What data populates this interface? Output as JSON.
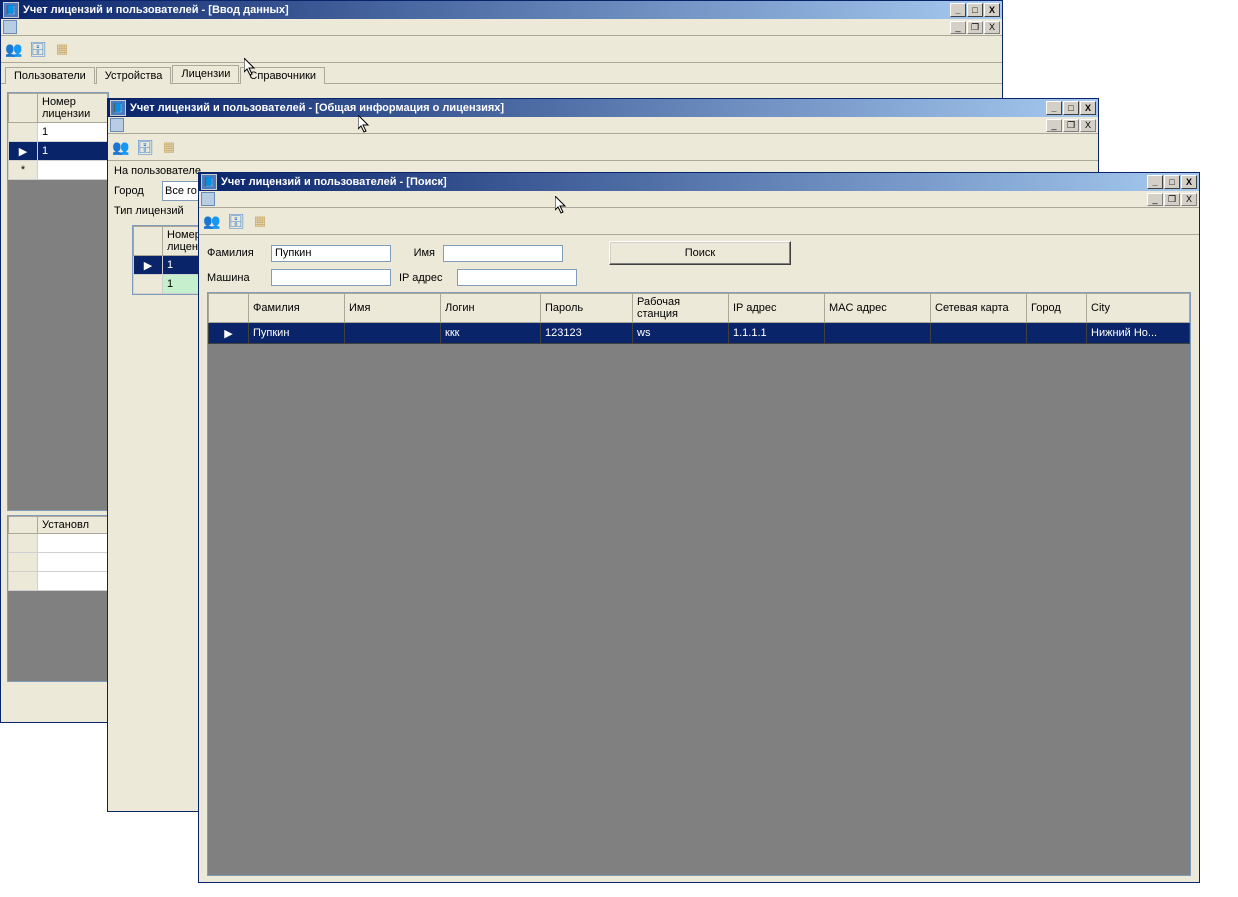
{
  "win1": {
    "title": "Учет лицензий и пользователей - [Ввод данных]",
    "tabs": [
      "Пользователи",
      "Устройства",
      "Лицензии",
      "Справочники"
    ],
    "active_tab": 2,
    "grid1": {
      "headers": [
        "Номер лицензии"
      ],
      "rows": [
        {
          "sel": false,
          "cells": [
            "1"
          ]
        },
        {
          "sel": true,
          "cells": [
            "1"
          ]
        },
        {
          "sel": false,
          "new": true,
          "cells": [
            ""
          ]
        }
      ]
    },
    "grid2": {
      "headers": [
        "Установл"
      ]
    }
  },
  "win2": {
    "title": "Учет лицензий и пользователей - [Общая информация о лицензиях]",
    "label_users": "На пользователе",
    "label_city": "Город",
    "city_value": "Все го",
    "label_lictype": "Тип лицензий",
    "grid": {
      "headers": [
        "Номер лицен"
      ],
      "rows": [
        {
          "sel": true,
          "cells": [
            "1"
          ]
        },
        {
          "green": true,
          "cells": [
            "1"
          ]
        }
      ]
    }
  },
  "win3": {
    "title": "Учет лицензий и пользователей - [Поиск]",
    "form": {
      "label_lname": "Фамилия",
      "value_lname": "Пупкин",
      "label_fname": "Имя",
      "value_fname": "",
      "label_machine": "Машина",
      "value_machine": "",
      "label_ip": "IP адрес",
      "value_ip": "",
      "button": "Поиск"
    },
    "grid": {
      "headers": [
        "",
        "Фамилия",
        "Имя",
        "Логин",
        "Пароль",
        "Рабочая станция",
        "IP адрес",
        "MAC адрес",
        "Сетевая карта",
        "Город",
        "City"
      ],
      "row": {
        "marker": "▶",
        "cells": [
          "Пупкин",
          "",
          "ккк",
          "123123",
          "ws",
          "1.1.1.1",
          "",
          "",
          "",
          "Нижний Но..."
        ]
      }
    }
  },
  "winbuttons": {
    "min": "_",
    "max": "□",
    "close": "X",
    "restore": "❐"
  }
}
